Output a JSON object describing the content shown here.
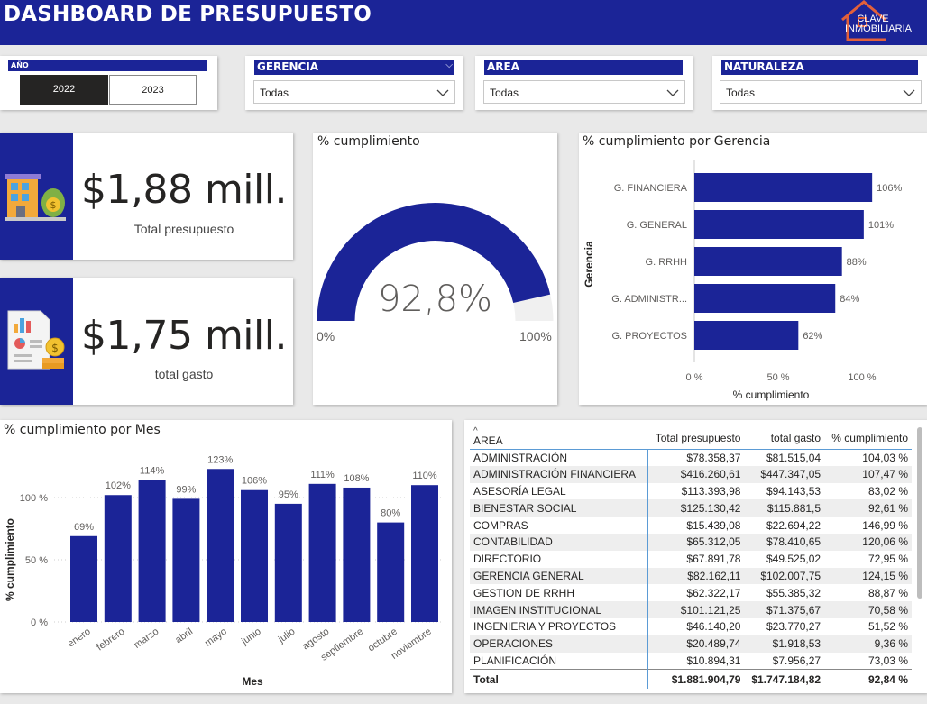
{
  "header": {
    "title": "DASHBOARD DE PRESUPUESTO",
    "logo_line1": "CLAVE",
    "logo_line2": "INMOBILIARIA"
  },
  "filters": {
    "year": {
      "title": "AÑO",
      "options": [
        "2022",
        "2023"
      ],
      "selected": "2022"
    },
    "gerencia": {
      "title": "GERENCIA",
      "value": "Todas"
    },
    "area": {
      "title": "AREA",
      "value": "Todas"
    },
    "naturaleza": {
      "title": "NATURALEZA",
      "value": "Todas"
    }
  },
  "kpis": {
    "presupuesto": {
      "value": "$1,88 mill.",
      "label": "Total presupuesto",
      "icon": "building-money-icon"
    },
    "gasto": {
      "value": "$1,75 mill.",
      "label": "total gasto",
      "icon": "report-coins-icon"
    }
  },
  "gauge": {
    "title": "% cumplimiento",
    "value_label": "92,8%",
    "min_label": "0%",
    "max_label": "100%",
    "value": 92.8,
    "min": 0,
    "max": 100,
    "fill_color": "#1b2497",
    "track_color": "#f0f0f0"
  },
  "chart_data": [
    {
      "type": "bar",
      "orientation": "horizontal",
      "title": "% cumplimiento por Gerencia",
      "xlabel": "% cumplimiento",
      "ylabel": "Gerencia",
      "categories": [
        "G. FINANCIERA",
        "G. GENERAL",
        "G. RRHH",
        "G. ADMINISTR...",
        "G. PROYECTOS"
      ],
      "values": [
        106,
        101,
        88,
        84,
        62
      ],
      "data_labels": [
        "106%",
        "101%",
        "88%",
        "84%",
        "62%"
      ],
      "ticks": [
        "0 %",
        "50 %",
        "100 %"
      ],
      "xlim": [
        0,
        100
      ],
      "color": "#1b2497"
    },
    {
      "type": "bar",
      "orientation": "vertical",
      "title": "% cumplimiento por Mes",
      "xlabel": "Mes",
      "ylabel": "% cumplimiento",
      "categories": [
        "enero",
        "febrero",
        "marzo",
        "abril",
        "mayo",
        "junio",
        "julio",
        "agosto",
        "septiembre",
        "octubre",
        "noviembre"
      ],
      "values": [
        69,
        102,
        114,
        99,
        123,
        106,
        95,
        111,
        108,
        80,
        110
      ],
      "data_labels": [
        "69%",
        "102%",
        "114%",
        "99%",
        "123%",
        "106%",
        "95%",
        "111%",
        "108%",
        "80%",
        "110%"
      ],
      "ticks": [
        "0 %",
        "50 %",
        "100 %"
      ],
      "ylim": [
        0,
        100
      ],
      "grid": true,
      "color": "#1b2497"
    }
  ],
  "table": {
    "columns": [
      "AREA",
      "Total presupuesto",
      "total gasto",
      "% cumplimiento"
    ],
    "rows": [
      [
        "ADMINISTRACIÓN",
        "$78.358,37",
        "$81.515,04",
        "104,03 %"
      ],
      [
        "ADMINISTRACIÓN FINANCIERA",
        "$416.260,61",
        "$447.347,05",
        "107,47 %"
      ],
      [
        "ASESORÍA LEGAL",
        "$113.393,98",
        "$94.143,53",
        "83,02 %"
      ],
      [
        "BIENESTAR SOCIAL",
        "$125.130,42",
        "$115.881,5",
        "92,61 %"
      ],
      [
        "COMPRAS",
        "$15.439,08",
        "$22.694,22",
        "146,99 %"
      ],
      [
        "CONTABILIDAD",
        "$65.312,05",
        "$78.410,65",
        "120,06 %"
      ],
      [
        "DIRECTORIO",
        "$67.891,78",
        "$49.525,02",
        "72,95 %"
      ],
      [
        "GERENCIA GENERAL",
        "$82.162,11",
        "$102.007,75",
        "124,15 %"
      ],
      [
        "GESTION DE RRHH",
        "$62.322,17",
        "$55.385,32",
        "88,87 %"
      ],
      [
        "IMAGEN INSTITUCIONAL",
        "$101.121,25",
        "$71.375,67",
        "70,58 %"
      ],
      [
        "INGENIERIA Y PROYECTOS",
        "$46.140,20",
        "$23.770,27",
        "51,52 %"
      ],
      [
        "OPERACIONES",
        "$20.489,74",
        "$1.918,53",
        "9,36 %"
      ],
      [
        "PLANIFICACIÓN",
        "$10.894,31",
        "$7.956,27",
        "73,03 %"
      ]
    ],
    "total": [
      "Total",
      "$1.881.904,79",
      "$1.747.184,82",
      "92,84 %"
    ]
  }
}
